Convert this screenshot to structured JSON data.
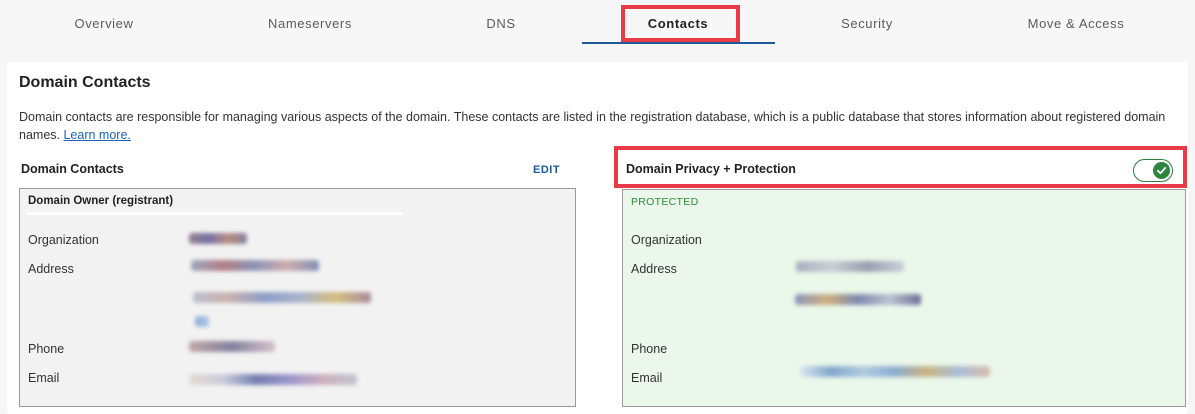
{
  "tabs": [
    {
      "label": "Overview"
    },
    {
      "label": "Nameservers"
    },
    {
      "label": "DNS"
    },
    {
      "label": "Contacts"
    },
    {
      "label": "Security"
    },
    {
      "label": "Move & Access"
    }
  ],
  "active_tab": "Contacts",
  "section": {
    "title": "Domain Contacts",
    "description": "Domain contacts are responsible for managing various aspects of the domain. These contacts are listed in the registration database, which is a public database that stores information about registered domain names.",
    "learn_more": "Learn more."
  },
  "left_panel": {
    "heading": "Domain Contacts",
    "edit_label": "EDIT",
    "owner_title": "Domain Owner (registrant)",
    "labels": {
      "organization": "Organization",
      "address": "Address",
      "phone": "Phone",
      "email": "Email"
    }
  },
  "right_panel": {
    "heading": "Domain Privacy + Protection",
    "toggle_on": true,
    "status": "PROTECTED",
    "labels": {
      "organization": "Organization",
      "address": "Address",
      "phone": "Phone",
      "email": "Email"
    }
  },
  "colors": {
    "highlight": "#e93a47",
    "accent": "#1e5a9a",
    "protected_green": "#2e8b3a",
    "protected_bg": "#eaf7ea"
  },
  "icons": {
    "toggle_check": "check-icon"
  }
}
